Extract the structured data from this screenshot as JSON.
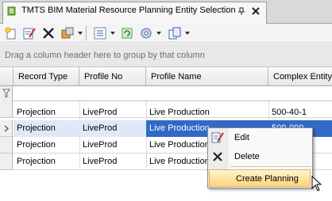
{
  "tab": {
    "title": "TMTS BIM Material Resource Planning Entity Selection",
    "pin_glyph": "ᵖ",
    "close_glyph": "✕"
  },
  "toolbar": {
    "icons": [
      "new-icon",
      "edit-icon",
      "delete-icon",
      "tools-icon",
      "list-icon",
      "refresh-icon",
      "settings-icon",
      "export-icon"
    ]
  },
  "group_panel": {
    "text": "Drag a column header here to group by that column"
  },
  "grid": {
    "columns": [
      "Record Type",
      "Profile No",
      "Profile Name",
      "Complex Entity"
    ],
    "rows": [
      {
        "record_type": "Projection",
        "profile_no": "LiveProd",
        "profile_name": "Live Production",
        "complex_entity": "500-40-1"
      },
      {
        "record_type": "Projection",
        "profile_no": "LiveProd",
        "profile_name": "Live Production",
        "complex_entity": "500-000"
      },
      {
        "record_type": "Projection",
        "profile_no": "LiveProd",
        "profile_name": "Live Production",
        "complex_entity": ""
      },
      {
        "record_type": "Projection",
        "profile_no": "LiveProd",
        "profile_name": "Live Production",
        "complex_entity": ""
      }
    ]
  },
  "context_menu": {
    "items": [
      {
        "label": "Edit",
        "icon": "edit-icon"
      },
      {
        "label": "Delete",
        "icon": "delete-icon"
      },
      {
        "label": "Create Planning",
        "icon": ""
      }
    ]
  },
  "colors": {
    "selection": "#3169c6",
    "highlight": "#ffd57a"
  }
}
